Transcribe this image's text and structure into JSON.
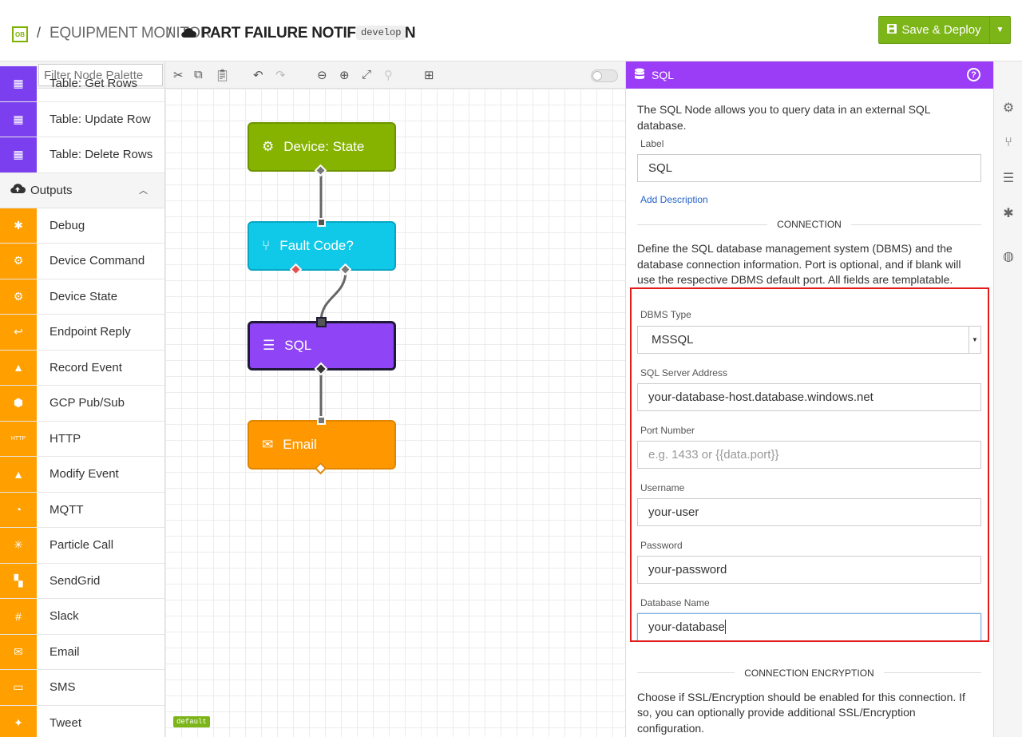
{
  "header": {
    "logo": "OB",
    "separator": "/",
    "app_name": "EQUIPMENT MONITOR",
    "flow_name": "PART FAILURE NOTIFICATION",
    "branch": "develop",
    "deploy_label": "Save & Deploy",
    "accent": "#7cb518"
  },
  "palette": {
    "filter_placeholder": "Filter Node Palette",
    "top_items": [
      {
        "label": "Table: Get Rows",
        "icon": "table-icon",
        "color": "#7b3ff0"
      },
      {
        "label": "Table: Update Row",
        "icon": "table-icon",
        "color": "#7b3ff0"
      },
      {
        "label": "Table: Delete Rows",
        "icon": "table-icon",
        "color": "#7b3ff0"
      }
    ],
    "category": "Outputs",
    "outputs": [
      {
        "label": "Debug",
        "icon": "bug-icon"
      },
      {
        "label": "Device Command",
        "icon": "chip-icon"
      },
      {
        "label": "Device State",
        "icon": "chip-icon"
      },
      {
        "label": "Endpoint Reply",
        "icon": "reply-icon"
      },
      {
        "label": "Record Event",
        "icon": "warning-icon"
      },
      {
        "label": "GCP Pub/Sub",
        "icon": "gcp-icon"
      },
      {
        "label": "HTTP",
        "icon": "http-icon"
      },
      {
        "label": "Modify Event",
        "icon": "warning-icon"
      },
      {
        "label": "MQTT",
        "icon": "mqtt-icon"
      },
      {
        "label": "Particle Call",
        "icon": "particle-icon"
      },
      {
        "label": "SendGrid",
        "icon": "sendgrid-icon"
      },
      {
        "label": "Slack",
        "icon": "slack-icon"
      },
      {
        "label": "Email",
        "icon": "envelope-icon"
      },
      {
        "label": "SMS",
        "icon": "sms-icon"
      },
      {
        "label": "Tweet",
        "icon": "twitter-icon"
      }
    ],
    "output_color": "#ff9f00"
  },
  "canvas": {
    "nodes": [
      {
        "label": "Device: State",
        "color": "#85b300",
        "border": "#6d9400"
      },
      {
        "label": "Fault Code?",
        "color": "#10c9e8",
        "border": "#07a6c3"
      },
      {
        "label": "SQL",
        "color": "#8f45f5",
        "border": "#1f1a3a"
      },
      {
        "label": "Email",
        "color": "#ff9800",
        "border": "#e08500"
      }
    ],
    "tag": "default"
  },
  "panel": {
    "title": "SQL",
    "help": "?",
    "color": "#9b3cf6",
    "intro": "The SQL Node allows you to query data in an external SQL database.",
    "label_caption": "Label",
    "label_value": "SQL",
    "add_description": "Add Description",
    "connection_heading": "CONNECTION",
    "connection_desc": "Define the SQL database management system (DBMS) and the database connection information. Port is optional, and if blank will use the respective DBMS default port. All fields are templatable.",
    "fields": {
      "dbms_caption": "DBMS Type",
      "dbms_value": "MSSQL",
      "server_caption": "SQL Server Address",
      "server_value": "your-database-host.database.windows.net",
      "port_caption": "Port Number",
      "port_placeholder": "e.g. 1433 or {{data.port}}",
      "user_caption": "Username",
      "user_value": "your-user",
      "password_caption": "Password",
      "password_value": "your-password",
      "db_caption": "Database Name",
      "db_value": "your-database"
    },
    "encryption_heading": "CONNECTION ENCRYPTION",
    "encryption_desc": "Choose if SSL/Encryption should be enabled for this connection. If so, you can optionally provide additional SSL/Encryption configuration."
  }
}
